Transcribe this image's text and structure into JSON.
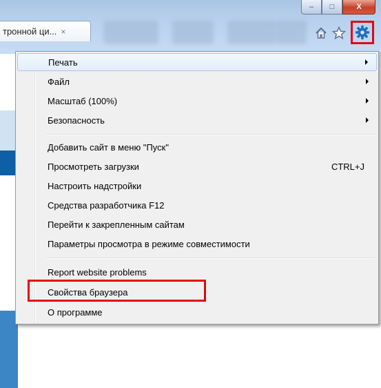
{
  "window": {
    "minimize_glyph": "‒",
    "maximize_glyph": "□",
    "close_glyph": "X"
  },
  "tab": {
    "title": "тронной ци...",
    "close_glyph": "×"
  },
  "toolbar": {
    "icons": [
      "home-icon",
      "favorites-star-icon",
      "gear-icon"
    ]
  },
  "menu": {
    "items": [
      {
        "label": "Печать",
        "submenu": true
      },
      {
        "label": "Файл",
        "submenu": true
      },
      {
        "label": "Масштаб (100%)",
        "submenu": true
      },
      {
        "label": "Безопасность",
        "submenu": true
      },
      {
        "label": "Добавить сайт в меню \"Пуск\""
      },
      {
        "label": "Просмотреть загрузки",
        "shortcut": "CTRL+J"
      },
      {
        "label": "Настроить надстройки"
      },
      {
        "label": "Средства разработчика F12"
      },
      {
        "label": "Перейти к закрепленным сайтам"
      },
      {
        "label": "Параметры просмотра в режиме совместимости"
      },
      {
        "label": "Report website problems"
      },
      {
        "label": "Свойства браузера"
      },
      {
        "label": "О программе"
      }
    ]
  },
  "colors": {
    "highlight": "#e30613",
    "gear": "#1f6fc0"
  }
}
